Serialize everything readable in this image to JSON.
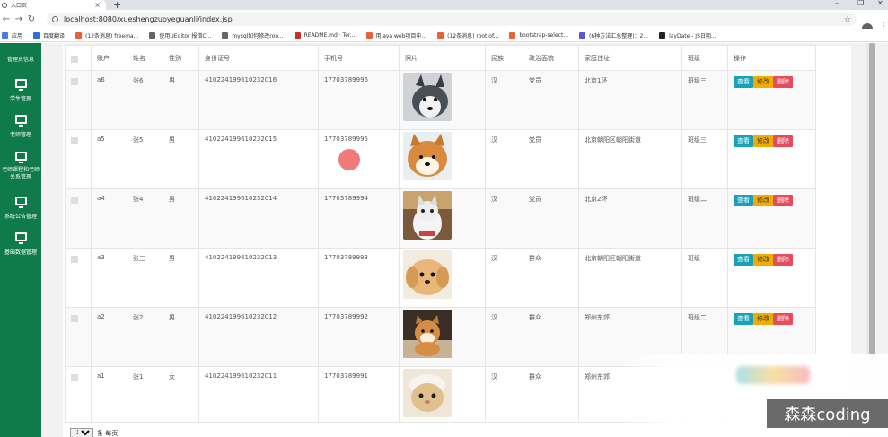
{
  "browser": {
    "tab_title": "入口页",
    "url": "localhost:8080/xueshengzuoyeguanli/index.jsp",
    "bookmarks": [
      {
        "label": "应用",
        "color": "#4a7ce8"
      },
      {
        "label": "百度翻译",
        "color": "#2a6ee0"
      },
      {
        "label": "(12条消息) freema...",
        "color": "#e8603c"
      },
      {
        "label": "使用UEditor 报错C...",
        "color": "#666666"
      },
      {
        "label": "mysql如何修改roo...",
        "color": "#666666"
      },
      {
        "label": "README.md · Ter...",
        "color": "#c7302b"
      },
      {
        "label": "用java web项目中...",
        "color": "#e8603c"
      },
      {
        "label": "(12条消息) root of...",
        "color": "#e8603c"
      },
      {
        "label": "bootstrap-select...",
        "color": "#e8603c"
      },
      {
        "label": "(6种方法汇总整理)：2...",
        "color": "#5a5ad6"
      },
      {
        "label": "layDate - JS日期...",
        "color": "#222222"
      }
    ]
  },
  "sidebar": {
    "items": [
      {
        "label": "管理员信息"
      },
      {
        "label": "学生管理"
      },
      {
        "label": "老师管理"
      },
      {
        "label_line1": "老师课程和老师",
        "label_line2": "关系管理"
      },
      {
        "label": "系统公告管理"
      },
      {
        "label": "基础数据管理"
      }
    ]
  },
  "table": {
    "headers": [
      "",
      "账户",
      "姓名",
      "性别",
      "身份证号",
      "手机号",
      "照片",
      "民族",
      "政治面貌",
      "家庭住址",
      "班级",
      "操作"
    ],
    "rows": [
      {
        "account": "a6",
        "name": "张6",
        "gender": "男",
        "id_card": "410224199610232016",
        "phone": "17703789996",
        "ethnicity": "汉",
        "politics": "党员",
        "address": "北京1环",
        "class": "班级三",
        "photo": "husky"
      },
      {
        "account": "a5",
        "name": "张5",
        "gender": "男",
        "id_card": "410224199610232015",
        "phone": "17703789995",
        "ethnicity": "汉",
        "politics": "党员",
        "address": "北京朝阳区朝阳街道",
        "class": "班级三",
        "photo": "shiba"
      },
      {
        "account": "a4",
        "name": "张4",
        "gender": "男",
        "id_card": "410224199610232014",
        "phone": "17703789994",
        "ethnicity": "汉",
        "politics": "党员",
        "address": "北京2环",
        "class": "班级二",
        "photo": "cat"
      },
      {
        "account": "a3",
        "name": "张三",
        "gender": "男",
        "id_card": "410224199610232013",
        "phone": "17703789993",
        "ethnicity": "汉",
        "politics": "群众",
        "address": "北京朝阳区朝阳街道",
        "class": "班级一",
        "photo": "puppy"
      },
      {
        "account": "a2",
        "name": "张2",
        "gender": "男",
        "id_card": "410224199610232012",
        "phone": "17703789992",
        "ethnicity": "汉",
        "politics": "群众",
        "address": "郑州东郊",
        "class": "班级二",
        "photo": "shiba2"
      },
      {
        "account": "a1",
        "name": "张1",
        "gender": "女",
        "id_card": "410224199610232011",
        "phone": "17703789991",
        "ethnicity": "汉",
        "politics": "群众",
        "address": "郑州东郊",
        "class": "",
        "photo": "cat2"
      }
    ],
    "actions": {
      "view": "查看",
      "edit": "修改",
      "delete": "删除"
    }
  },
  "pager": {
    "page_size": "10",
    "suffix": "条 每页"
  },
  "watermark": "森森coding",
  "colors": {
    "sidebar": "#0f7a4a",
    "view": "#17a2b8",
    "edit": "#f0ad00",
    "delete": "#e84c5c"
  }
}
